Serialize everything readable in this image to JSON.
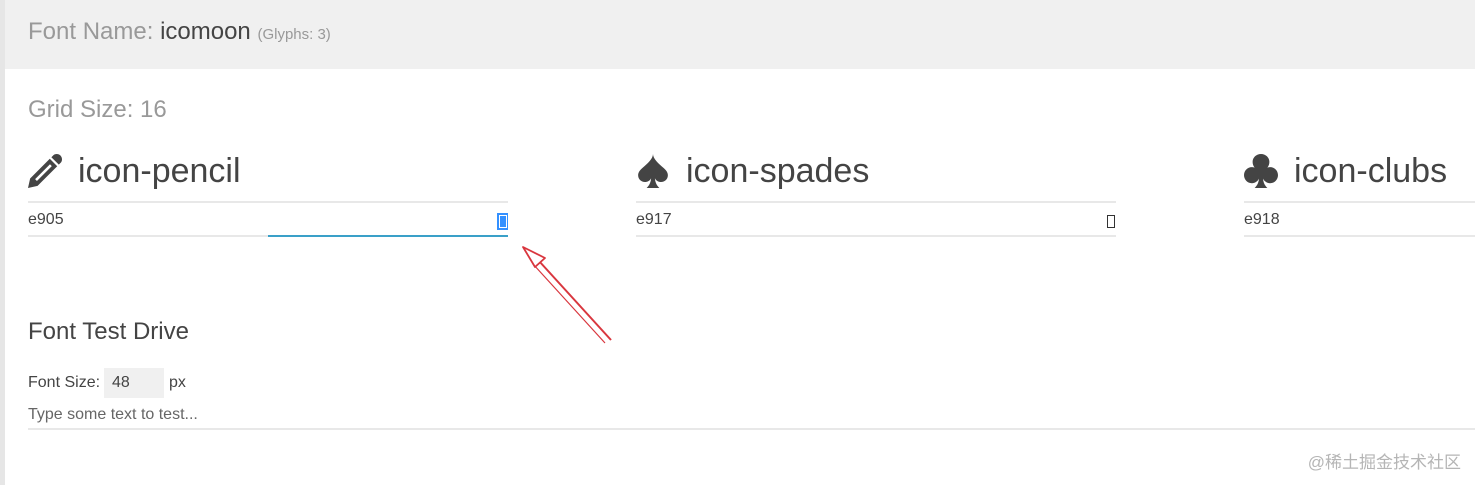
{
  "header": {
    "label": "Font Name:",
    "font_name": "icomoon",
    "glyph_count": "(Glyphs: 3)"
  },
  "grid_size": "Grid Size: 16",
  "glyphs": [
    {
      "icon": "pencil-icon",
      "name": "icon-pencil",
      "code": "e905",
      "selected": true
    },
    {
      "icon": "spades-icon",
      "name": "icon-spades",
      "code": "e917",
      "selected": false
    },
    {
      "icon": "clubs-icon",
      "name": "icon-clubs",
      "code": "e918",
      "selected": false
    }
  ],
  "test_drive": {
    "title": "Font Test Drive",
    "font_size_label": "Font Size:",
    "font_size_value": "48",
    "unit": "px",
    "test_placeholder": "Type some text to test..."
  },
  "watermark": "@稀土掘金技术社区",
  "colors": {
    "header_bg": "#f0f0f0",
    "accent": "#3aa0c8",
    "selection": "#3390ff",
    "annotation_arrow": "#d9363e"
  }
}
